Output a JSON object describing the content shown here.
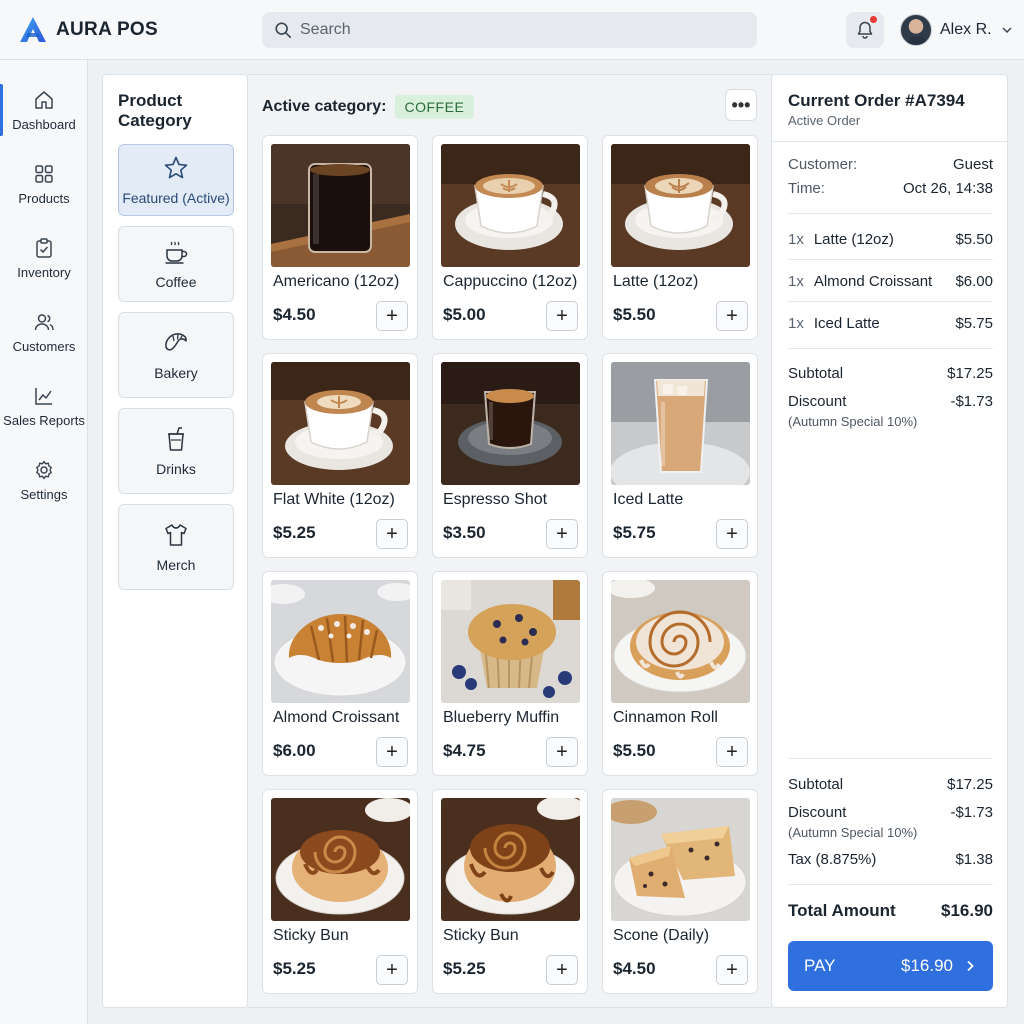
{
  "app": {
    "title": "AURA POS"
  },
  "search": {
    "placeholder": "Search"
  },
  "user": {
    "name": "Alex R."
  },
  "nav": {
    "items": [
      {
        "label": "Dashboard",
        "icon": "home-icon"
      },
      {
        "label": "Products",
        "icon": "grid-icon"
      },
      {
        "label": "Inventory",
        "icon": "clipboard-check-icon"
      },
      {
        "label": "Customers",
        "icon": "users-icon"
      },
      {
        "label": "Sales Reports",
        "icon": "line-chart-icon"
      },
      {
        "label": "Settings",
        "icon": "gear-icon"
      }
    ]
  },
  "categories": {
    "title": "Product Category",
    "items": [
      {
        "label": "Featured (Active)",
        "icon": "star-icon",
        "active": true
      },
      {
        "label": "Coffee",
        "icon": "coffee-cup-icon"
      },
      {
        "label": "Bakery",
        "icon": "croissant-icon"
      },
      {
        "label": "Drinks",
        "icon": "drink-cup-icon"
      },
      {
        "label": "Merch",
        "icon": "t-shirt-icon"
      }
    ]
  },
  "catalog": {
    "active_label": "Active category:",
    "active_value": "COFFEE",
    "more_label": "•••",
    "products": [
      {
        "name": "Americano (12oz)",
        "price": "$4.50",
        "image": "americano-glass-photo"
      },
      {
        "name": "Cappuccino (12oz)",
        "price": "$5.00",
        "image": "cappuccino-cup-photo"
      },
      {
        "name": "Latte (12oz)",
        "price": "$5.50",
        "image": "latte-cup-photo"
      },
      {
        "name": "Flat White (12oz)",
        "price": "$5.25",
        "image": "flat-white-cup-photo"
      },
      {
        "name": "Espresso Shot",
        "price": "$3.50",
        "image": "espresso-glass-photo"
      },
      {
        "name": "Iced Latte",
        "price": "$5.75",
        "image": "iced-latte-photo"
      },
      {
        "name": "Almond Croissant",
        "price": "$6.00",
        "image": "almond-croissant-photo"
      },
      {
        "name": "Blueberry Muffin",
        "price": "$4.75",
        "image": "blueberry-muffin-photo"
      },
      {
        "name": "Cinnamon Roll",
        "price": "$5.50",
        "image": "cinnamon-roll-photo"
      },
      {
        "name": "Sticky Bun",
        "price": "$5.25",
        "image": "sticky-bun-photo"
      },
      {
        "name": "Sticky Bun",
        "price": "$5.25",
        "image": "sticky-bun-photo"
      },
      {
        "name": "Scone (Daily)",
        "price": "$4.50",
        "image": "scone-photo"
      }
    ],
    "add_label": "+"
  },
  "order": {
    "title": "Current Order #A7394",
    "status": "Active Order",
    "customer_label": "Customer:",
    "customer_value": "Guest",
    "time_label": "Time:",
    "time_value": "Oct 26, 14:38",
    "items": [
      {
        "qty": "1x",
        "name": "Latte (12oz)",
        "price": "$5.50"
      },
      {
        "qty": "1x",
        "name": "Almond Croissant",
        "price": "$6.00"
      },
      {
        "qty": "1x",
        "name": "Iced Latte",
        "price": "$5.75"
      }
    ],
    "subtotal_label": "Subtotal",
    "subtotal_value": "$17.25",
    "discount_label": "Discount",
    "discount_value": "-$1.73",
    "discount_note": "(Autumn Special 10%)",
    "tax_label": "Tax (8.875%)",
    "tax_value": "$1.38",
    "total_label": "Total Amount",
    "total_value": "$16.90",
    "pay_label": "PAY",
    "pay_amount": "$16.90"
  },
  "colors": {
    "accent": "#2f6fde",
    "badge_bg": "#d8f0dc",
    "badge_text": "#2d6b3a",
    "alert": "#e53935"
  }
}
